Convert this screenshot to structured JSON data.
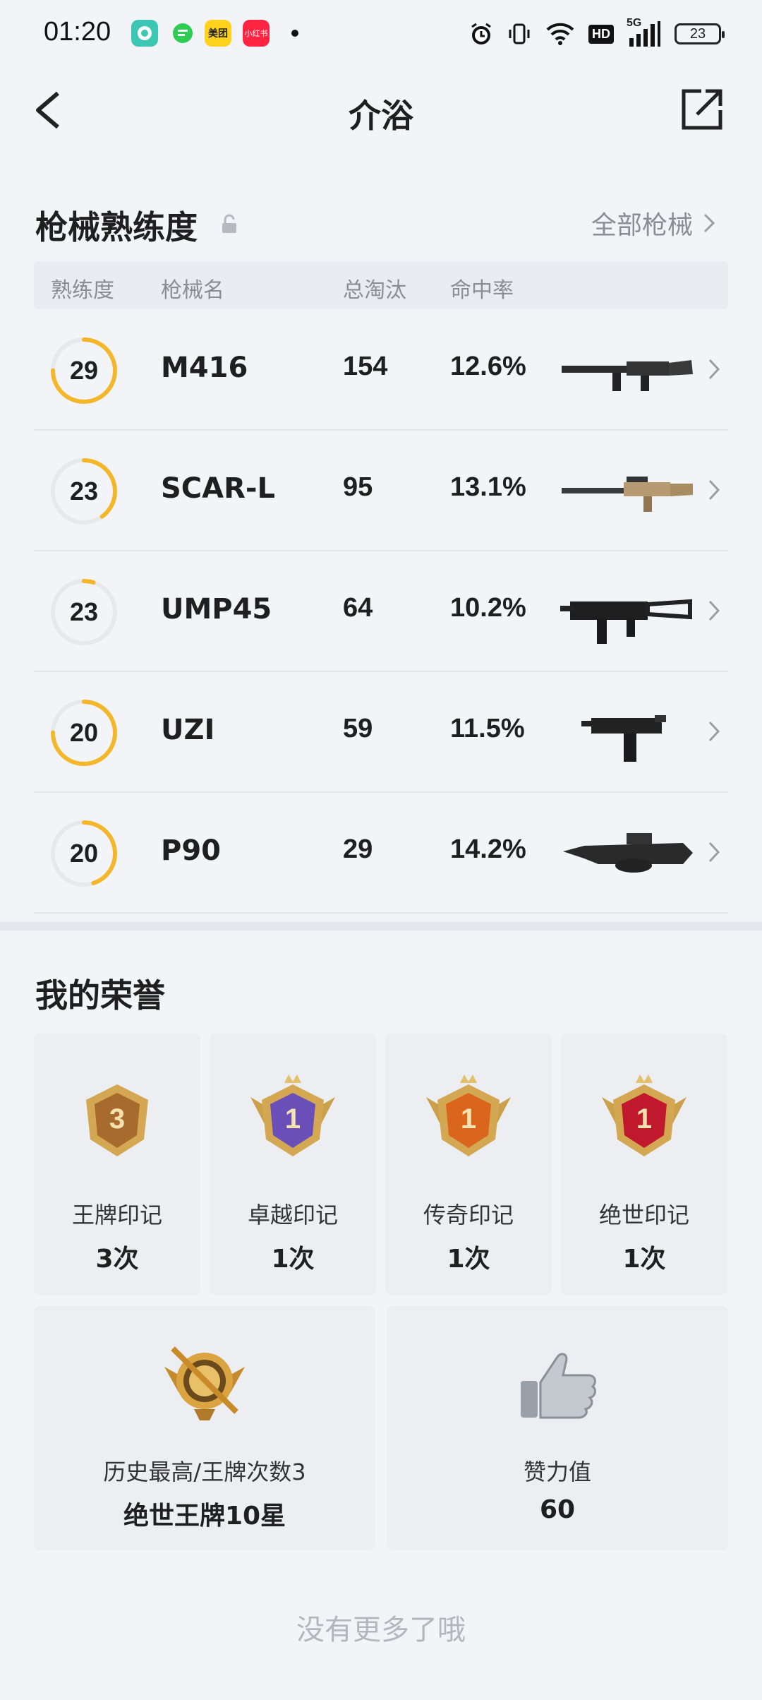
{
  "status_bar": {
    "time": "01:20",
    "notification_icons": [
      "chat-app-icon",
      "messenger-icon",
      "meituan-icon",
      "xiaohongshu-icon"
    ],
    "meituan_label": "美团",
    "xhs_label": "小红书",
    "network": "5G",
    "hd": "HD",
    "battery": "23"
  },
  "header": {
    "title": "介浴"
  },
  "weapons": {
    "section_title": "枪械熟练度",
    "all_link": "全部枪械",
    "columns": {
      "proficiency": "熟练度",
      "name": "枪械名",
      "kills": "总淘汰",
      "hit_rate": "命中率"
    },
    "rows": [
      {
        "level": "29",
        "progress": 0.75,
        "name": "M416",
        "kills": "154",
        "hit_rate": "12.6%"
      },
      {
        "level": "23",
        "progress": 0.4,
        "name": "SCAR-L",
        "kills": "95",
        "hit_rate": "13.1%"
      },
      {
        "level": "23",
        "progress": 0.05,
        "name": "UMP45",
        "kills": "64",
        "hit_rate": "10.2%"
      },
      {
        "level": "20",
        "progress": 0.75,
        "name": "UZI",
        "kills": "59",
        "hit_rate": "11.5%"
      },
      {
        "level": "20",
        "progress": 0.45,
        "name": "P90",
        "kills": "29",
        "hit_rate": "14.2%"
      }
    ],
    "ring_color": "#f5b72a",
    "ring_track": "#e6e8ec"
  },
  "honors": {
    "section_title": "我的荣誉",
    "badges": [
      {
        "label": "王牌印记",
        "value": "3次",
        "badge_text": "3",
        "color": "#a66b2d"
      },
      {
        "label": "卓越印记",
        "value": "1次",
        "badge_text": "1",
        "color": "#6b4fb8"
      },
      {
        "label": "传奇印记",
        "value": "1次",
        "badge_text": "1",
        "color": "#d9661c"
      },
      {
        "label": "绝世印记",
        "value": "1次",
        "badge_text": "1",
        "color": "#c0182c"
      }
    ],
    "highest": {
      "label": "历史最高/王牌次数3",
      "value": "绝世王牌10星"
    },
    "likes": {
      "label": "赞力值",
      "value": "60"
    }
  },
  "footer": "没有更多了哦"
}
